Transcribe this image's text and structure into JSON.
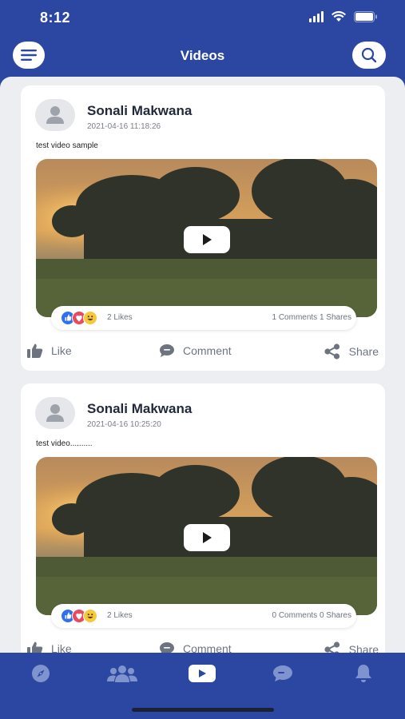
{
  "status_bar": {
    "time": "8:12"
  },
  "header": {
    "title": "Videos",
    "menu_icon": "menu-icon",
    "search_icon": "search-icon"
  },
  "posts": [
    {
      "author": "Sonali Makwana",
      "timestamp": "2021-04-16 11:18:26",
      "text": "test video sample",
      "likes": "2 Likes",
      "comments": "1 Comments",
      "shares": "1 Shares",
      "actions": {
        "like": "Like",
        "comment": "Comment",
        "share": "Share"
      }
    },
    {
      "author": "Sonali Makwana",
      "timestamp": "2021-04-16 10:25:20",
      "text": "test video..........",
      "likes": "2 Likes",
      "comments": "0 Comments",
      "shares": "0 Shares",
      "actions": {
        "like": "Like",
        "comment": "Comment",
        "share": "Share"
      }
    }
  ],
  "bottom_nav": [
    {
      "icon": "compass-icon",
      "active": false
    },
    {
      "icon": "group-icon",
      "active": false
    },
    {
      "icon": "youtube-play-icon",
      "active": true
    },
    {
      "icon": "chat-icon",
      "active": false
    },
    {
      "icon": "bell-icon",
      "active": false
    }
  ],
  "colors": {
    "brand": "#2c47a1",
    "background": "#eceef2",
    "muted": "#6d7480",
    "nav_inactive": "#7f93cf"
  }
}
